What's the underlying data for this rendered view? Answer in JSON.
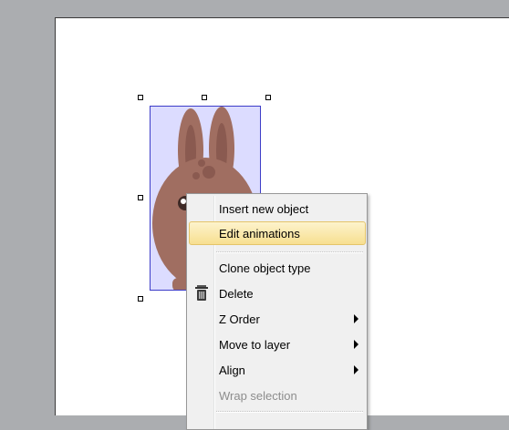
{
  "context_menu": {
    "items": [
      {
        "label": "Insert new object",
        "state": "normal"
      },
      {
        "label": "Edit animations",
        "state": "highlighted"
      },
      {
        "label": "Clone object type",
        "state": "normal"
      },
      {
        "label": "Delete",
        "state": "normal",
        "icon": "trash-icon"
      },
      {
        "label": "Z Order",
        "state": "normal",
        "submenu": true
      },
      {
        "label": "Move to layer",
        "state": "normal",
        "submenu": true
      },
      {
        "label": "Align",
        "state": "normal",
        "submenu": true
      },
      {
        "label": "Wrap selection",
        "state": "disabled"
      }
    ]
  },
  "colors": {
    "workspace": "#abadb0",
    "layout_background": "#ffffff",
    "selection_fill": "#dcdcff",
    "selection_border": "#3c3cc8",
    "highlight": "#f7df90",
    "sprite_body": "#a06e61"
  }
}
